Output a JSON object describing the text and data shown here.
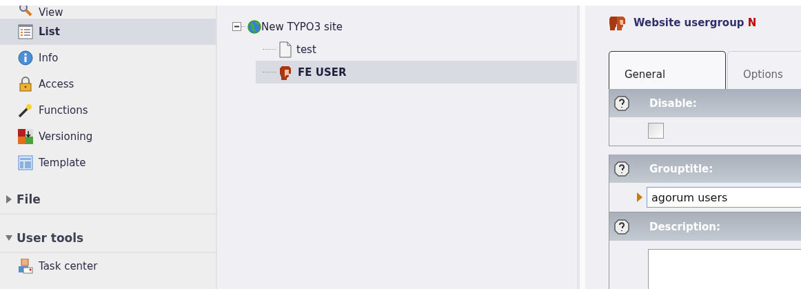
{
  "sidebar": {
    "items": [
      {
        "label": "View",
        "kind": "magnifier",
        "selected": false
      },
      {
        "label": "List",
        "kind": "list",
        "selected": true
      },
      {
        "label": "Info",
        "kind": "info",
        "selected": false
      },
      {
        "label": "Access",
        "kind": "lock",
        "selected": false
      },
      {
        "label": "Functions",
        "kind": "wand",
        "selected": false
      },
      {
        "label": "Versioning",
        "kind": "versioning",
        "selected": false
      },
      {
        "label": "Template",
        "kind": "template",
        "selected": false
      }
    ],
    "groups": [
      {
        "label": "File",
        "expanded": false
      },
      {
        "label": "User tools",
        "expanded": true,
        "items": [
          {
            "label": "Task center",
            "kind": "taskcenter",
            "selected": false
          }
        ]
      }
    ]
  },
  "tree": {
    "root": {
      "label": "New TYPO3 site",
      "kind": "site",
      "expanded": true,
      "selected": false,
      "children": [
        {
          "label": "test",
          "kind": "page",
          "selected": false
        },
        {
          "label": "FE USER",
          "kind": "user",
          "selected": true
        }
      ]
    }
  },
  "editor": {
    "title": "Website usergroup",
    "record_name": "N",
    "tabs": [
      {
        "label": "General",
        "selected": true
      },
      {
        "label": "Options",
        "selected": false
      }
    ],
    "fields": [
      {
        "kind": "checkbox",
        "label": "Disable:",
        "checked": false
      },
      {
        "kind": "text",
        "label": "Grouptitle:",
        "value": "agorum users"
      },
      {
        "kind": "textarea",
        "label": "Description:"
      }
    ]
  }
}
